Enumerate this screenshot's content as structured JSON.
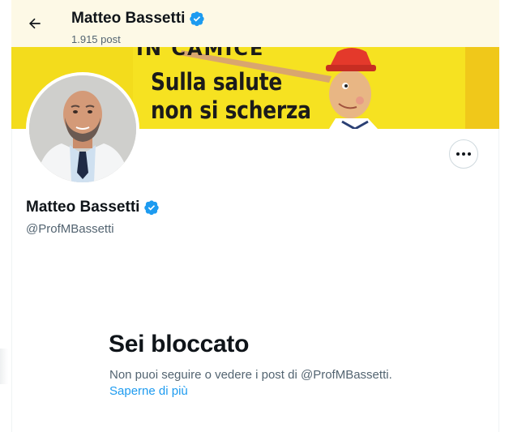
{
  "header": {
    "name": "Matteo Bassetti",
    "post_count": "1.915 post"
  },
  "banner": {
    "top_text": "IN CAMICE",
    "line1": "Sulla salute",
    "line2": "non si scherza"
  },
  "profile": {
    "name": "Matteo Bassetti",
    "handle": "@ProfMBassetti"
  },
  "blocked": {
    "title": "Sei bloccato",
    "message": "Non puoi seguire o vedere i post di @ProfMBassetti.",
    "link": "Saperne di più"
  },
  "colors": {
    "accent": "#1d9bf0",
    "header_bg": "#fdf9e6",
    "banner_bg": "#f6e221"
  },
  "icons": {
    "back": "arrow-left-icon",
    "verified": "verified-badge-icon",
    "more": "more-horizontal-icon"
  }
}
